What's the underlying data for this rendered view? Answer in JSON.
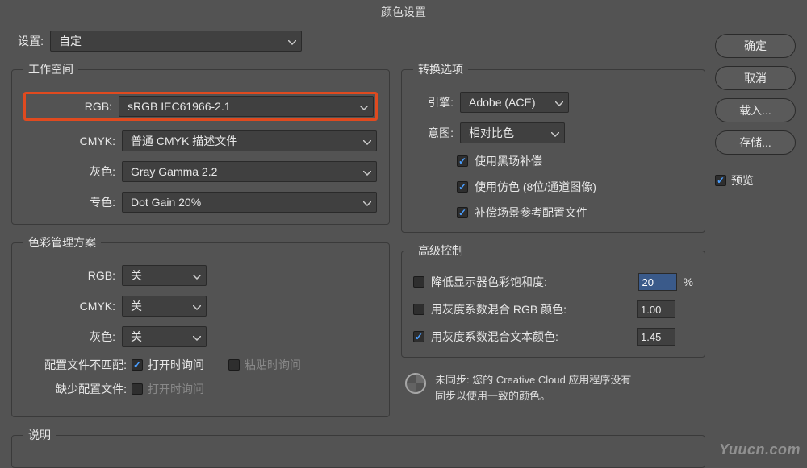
{
  "dialog_title": "颜色设置",
  "settings": {
    "label": "设置:",
    "value": "自定"
  },
  "workspace": {
    "legend": "工作空间",
    "rgb_label": "RGB:",
    "rgb_value": "sRGB IEC61966-2.1",
    "cmyk_label": "CMYK:",
    "cmyk_value": "普通 CMYK 描述文件",
    "gray_label": "灰色:",
    "gray_value": "Gray Gamma 2.2",
    "spot_label": "专色:",
    "spot_value": "Dot Gain 20%"
  },
  "policy": {
    "legend": "色彩管理方案",
    "rgb_label": "RGB:",
    "rgb_value": "关",
    "cmyk_label": "CMYK:",
    "cmyk_value": "关",
    "gray_label": "灰色:",
    "gray_value": "关",
    "mismatch_label": "配置文件不匹配:",
    "mismatch_open": "打开时询问",
    "mismatch_paste": "粘贴时询问",
    "missing_label": "缺少配置文件:",
    "missing_open": "打开时询问"
  },
  "conversion": {
    "legend": "转换选项",
    "engine_label": "引擎:",
    "engine_value": "Adobe (ACE)",
    "intent_label": "意图:",
    "intent_value": "相对比色",
    "blackpoint": "使用黑场补偿",
    "dither": "使用仿色 (8位/通道图像)",
    "compensate": "补偿场景参考配置文件"
  },
  "advanced": {
    "legend": "高级控制",
    "desat_label": "降低显示器色彩饱和度:",
    "desat_value": "20",
    "desat_unit": "%",
    "blend_rgb_label": "用灰度系数混合 RGB 颜色:",
    "blend_rgb_value": "1.00",
    "blend_text_label": "用灰度系数混合文本颜色:",
    "blend_text_value": "1.45"
  },
  "sync": {
    "text1": "未同步: 您的 Creative Cloud 应用程序没有",
    "text2": "同步以使用一致的颜色。"
  },
  "desc": {
    "legend": "说明"
  },
  "buttons": {
    "ok": "确定",
    "cancel": "取消",
    "load": "载入...",
    "save": "存储..."
  },
  "preview": {
    "label": "预览"
  },
  "watermark": "Yuucn.com"
}
